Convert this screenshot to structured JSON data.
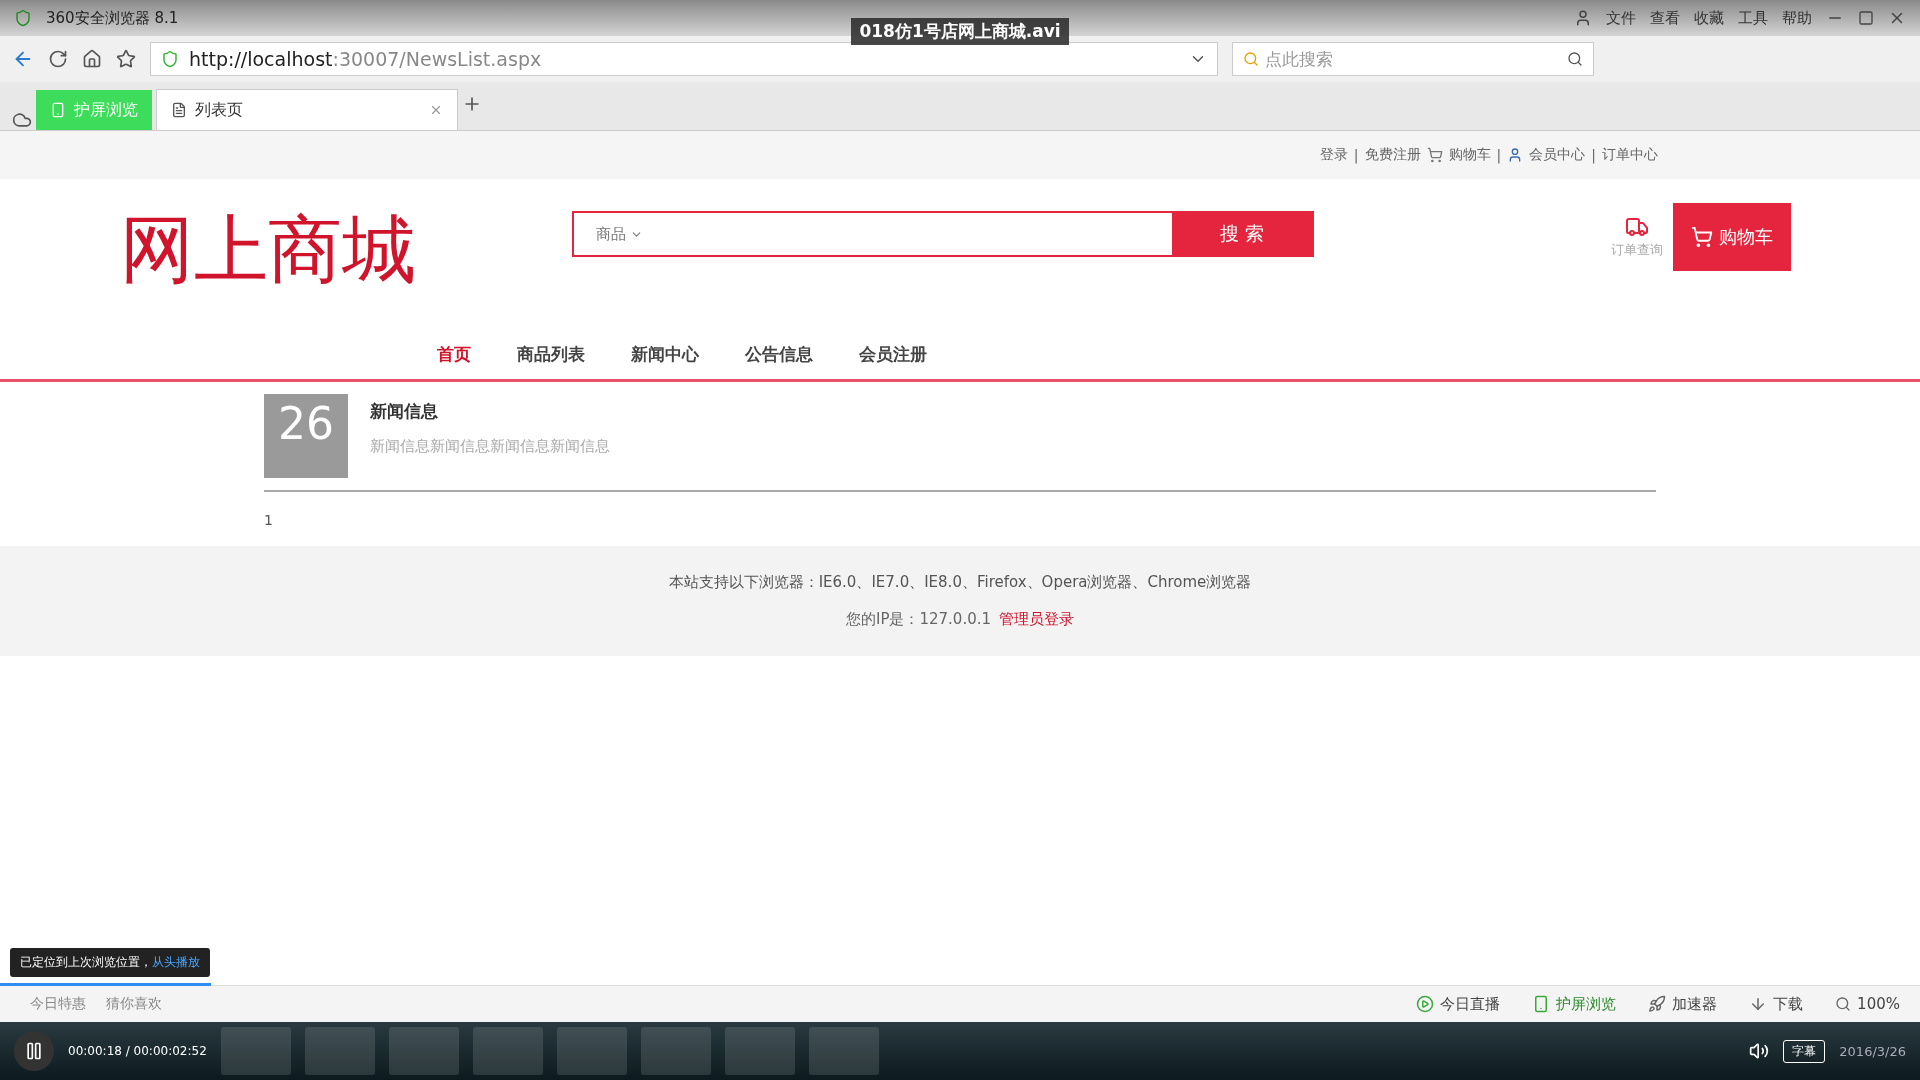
{
  "player": {
    "title": "018仿1号店网上商城.avi",
    "time": "00:00:18 / 00:00:02:52",
    "level": 0.11,
    "toast": "已定位到上次浏览位置，",
    "toast_link": "从头播放",
    "subtitle_button": "字幕"
  },
  "browser": {
    "title": "360安全浏览器 8.1",
    "menu": [
      "文件",
      "查看",
      "收藏",
      "工具",
      "帮助"
    ],
    "url_host": "http://localhost",
    "url_rest": ":30007/NewsList.aspx",
    "search_placeholder": "点此搜索",
    "tabs": [
      {
        "label": "护屏浏览",
        "kind": "special",
        "selected": false
      },
      {
        "label": "列表页",
        "kind": "page",
        "selected": true
      }
    ],
    "status": [
      "今日直播",
      "护屏浏览",
      "加速器",
      "下载",
      "100%"
    ],
    "status_left": [
      "今日特惠",
      "猜你喜欢"
    ]
  },
  "site": {
    "top_links": [
      "登录",
      "|",
      "免费注册",
      "购物车",
      "|",
      "会员中心",
      "|",
      "订单中心"
    ],
    "logo": "网上商城",
    "search_category": "商品",
    "search_button": "搜 索",
    "order_query": "订单查询",
    "cart_button": "购物车",
    "nav": [
      {
        "label": "首页",
        "selected": true
      },
      {
        "label": "商品列表",
        "selected": false
      },
      {
        "label": "新闻中心",
        "selected": false
      },
      {
        "label": "公告信息",
        "selected": false
      },
      {
        "label": "会员注册",
        "selected": false
      }
    ],
    "news": [
      {
        "day": "26",
        "title": "新闻信息",
        "summary": "新闻信息新闻信息新闻信息新闻信息"
      }
    ],
    "pages": [
      "1"
    ],
    "footer_browsers": "本站支持以下浏览器：IE6.0、IE7.0、IE8.0、Firefox、Opera浏览器、Chrome浏览器",
    "footer_ip": "您的IP是：127.0.0.1",
    "footer_admin": "管理员登录"
  },
  "taskbar": {
    "date": "2016/3/26"
  }
}
